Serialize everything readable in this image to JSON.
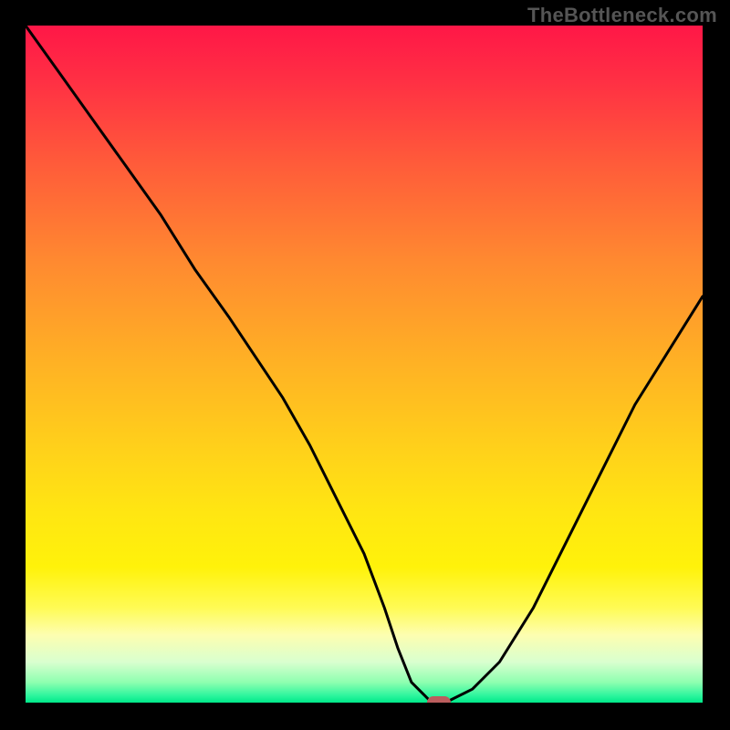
{
  "watermark": "TheBottleneck.com",
  "chart_data": {
    "type": "line",
    "title": "",
    "xlabel": "",
    "ylabel": "",
    "xlim": [
      0,
      100
    ],
    "ylim": [
      0,
      100
    ],
    "grid": false,
    "series": [
      {
        "name": "bottleneck-curve",
        "x": [
          0,
          5,
          10,
          15,
          20,
          25,
          30,
          34,
          38,
          42,
          46,
          50,
          53,
          55,
          57,
          59,
          60,
          62,
          66,
          70,
          75,
          80,
          85,
          90,
          95,
          100
        ],
        "values": [
          100,
          93,
          86,
          79,
          72,
          64,
          57,
          51,
          45,
          38,
          30,
          22,
          14,
          8,
          3,
          1,
          0,
          0,
          2,
          6,
          14,
          24,
          34,
          44,
          52,
          60
        ],
        "color": "#000000"
      }
    ],
    "marker": {
      "x": 61,
      "y": 0,
      "color": "#bb5e5e"
    },
    "background_gradient": {
      "top": "#ff1747",
      "mid": "#ffe300",
      "bottom": "#00e889"
    }
  }
}
